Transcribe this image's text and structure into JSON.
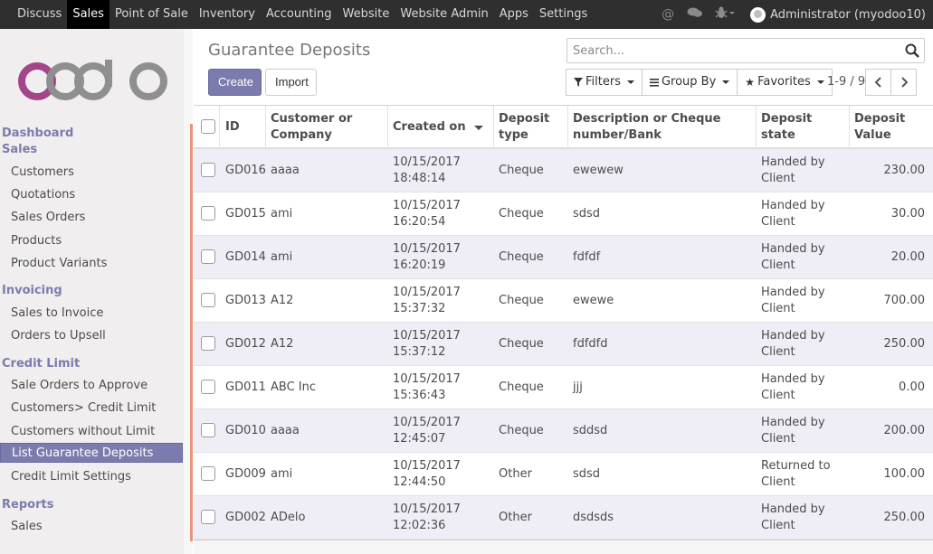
{
  "navbar": {
    "items": [
      "Discuss",
      "Sales",
      "Point of Sale",
      "Inventory",
      "Accounting",
      "Website",
      "Website Admin",
      "Apps",
      "Settings"
    ],
    "active": "Sales",
    "user": "Administrator (myodoo10)"
  },
  "sidebar": {
    "logo": "odoo",
    "dashboard": "Dashboard",
    "sections": [
      {
        "title": "Sales",
        "items": [
          "Customers",
          "Quotations",
          "Sales Orders",
          "Products",
          "Product Variants"
        ]
      },
      {
        "title": "Invoicing",
        "items": [
          "Sales to Invoice",
          "Orders to Upsell"
        ]
      },
      {
        "title": "Credit Limit",
        "items": [
          "Sale Orders to Approve",
          "Customers> Credit Limit",
          "Customers without Limit",
          "List Guarantee Deposits",
          "Credit Limit Settings"
        ]
      },
      {
        "title": "Reports",
        "items": [
          "Sales"
        ]
      }
    ],
    "active_item": "List Guarantee Deposits"
  },
  "control": {
    "title": "Guarantee Deposits",
    "create": "Create",
    "import": "Import",
    "search_placeholder": "Search...",
    "filters": "Filters",
    "group_by": "Group By",
    "favorites": "Favorites",
    "pager": "1-9 / 9"
  },
  "table": {
    "headers": {
      "id": "ID",
      "customer_l1": "Customer or",
      "customer_l2": "Company",
      "created": "Created on",
      "type_l1": "Deposit",
      "type_l2": "type",
      "desc_l1": "Description or Cheque",
      "desc_l2": "number/Bank",
      "state": "Deposit state",
      "value_l1": "Deposit",
      "value_l2": "Value"
    },
    "rows": [
      {
        "id": "GD016",
        "customer": "aaaa",
        "date": "10/15/2017",
        "time": "18:48:14",
        "type": "Cheque",
        "desc": "ewewew",
        "state1": "Handed by",
        "state2": "Client",
        "value": "230.00"
      },
      {
        "id": "GD015",
        "customer": "ami",
        "date": "10/15/2017",
        "time": "16:20:54",
        "type": "Cheque",
        "desc": "sdsd",
        "state1": "Handed by",
        "state2": "Client",
        "value": "30.00"
      },
      {
        "id": "GD014",
        "customer": "ami",
        "date": "10/15/2017",
        "time": "16:20:19",
        "type": "Cheque",
        "desc": "fdfdf",
        "state1": "Handed by",
        "state2": "Client",
        "value": "20.00"
      },
      {
        "id": "GD013",
        "customer": "A12",
        "date": "10/15/2017",
        "time": "15:37:32",
        "type": "Cheque",
        "desc": "ewewe",
        "state1": "Handed by",
        "state2": "Client",
        "value": "700.00"
      },
      {
        "id": "GD012",
        "customer": "A12",
        "date": "10/15/2017",
        "time": "15:37:12",
        "type": "Cheque",
        "desc": "fdfdfd",
        "state1": "Handed by",
        "state2": "Client",
        "value": "250.00"
      },
      {
        "id": "GD011",
        "customer": "ABC Inc",
        "date": "10/15/2017",
        "time": "15:36:43",
        "type": "Cheque",
        "desc": "jjj",
        "state1": "Handed by",
        "state2": "Client",
        "value": "0.00"
      },
      {
        "id": "GD010",
        "customer": "aaaa",
        "date": "10/15/2017",
        "time": "12:45:07",
        "type": "Cheque",
        "desc": "sddsd",
        "state1": "Handed by",
        "state2": "Client",
        "value": "200.00"
      },
      {
        "id": "GD009",
        "customer": "ami",
        "date": "10/15/2017",
        "time": "12:44:50",
        "type": "Other",
        "desc": "sdsd",
        "state1": "Returned to",
        "state2": "Client",
        "value": "100.00"
      },
      {
        "id": "GD002",
        "customer": "ADelo",
        "date": "10/15/2017",
        "time": "12:02:36",
        "type": "Other",
        "desc": "dsdsds",
        "state1": "Handed by",
        "state2": "Client",
        "value": "250.00"
      }
    ]
  },
  "colors": {
    "brand": "#7c7bad",
    "navbar": "#2f2f2f",
    "row_alt": "#efeef6"
  }
}
